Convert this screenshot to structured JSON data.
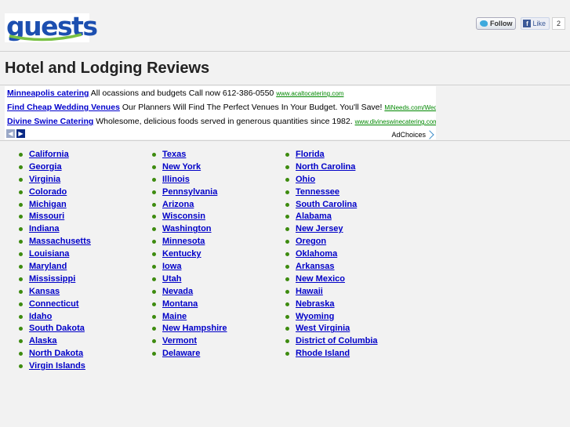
{
  "header": {
    "logo_text": "guests",
    "follow_label": "Follow",
    "like_label": "Like",
    "like_count": "2"
  },
  "page": {
    "title": "Hotel and Lodging Reviews"
  },
  "ads": {
    "items": [
      {
        "title": "Minneapolis catering",
        "text": "All ocassions and budgets Call now 612-386-0550",
        "url": "www.acaltocatering.com"
      },
      {
        "title": "Find Cheap Wedding Venues",
        "text": "Our Planners Will Find The Perfect Venues In Your Budget. You'll Save!",
        "url": "MiNeeds.com/Wedding-F"
      },
      {
        "title": "Divine Swine Catering",
        "text": "Wholesome, delicious foods served in generous quantities since 1982.",
        "url": "www.divineswinecatering.com"
      }
    ],
    "prev_arrow": "◀",
    "next_arrow": "▶",
    "adchoices_label": "AdChoices"
  },
  "states": {
    "col1": [
      "California",
      "Georgia",
      "Virginia",
      "Colorado",
      "Michigan",
      "Missouri",
      "Indiana",
      "Massachusetts",
      "Louisiana",
      "Maryland",
      "Mississippi",
      "Kansas",
      "Connecticut",
      "Idaho",
      "South Dakota",
      "Alaska",
      "North Dakota",
      "Virgin Islands"
    ],
    "col2": [
      "Texas",
      "New York",
      "Illinois",
      "Pennsylvania",
      "Arizona",
      "Wisconsin",
      "Washington",
      "Minnesota",
      "Kentucky",
      "Iowa",
      "Utah",
      "Nevada",
      "Montana",
      "Maine",
      "New Hampshire",
      "Vermont",
      "Delaware"
    ],
    "col3": [
      "Florida",
      "North Carolina",
      "Ohio",
      "Tennessee",
      "South Carolina",
      "Alabama",
      "New Jersey",
      "Oregon",
      "Oklahoma",
      "Arkansas",
      "New Mexico",
      "Hawaii",
      "Nebraska",
      "Wyoming",
      "West Virginia",
      "District of Columbia",
      "Rhode Island"
    ]
  },
  "colors": {
    "link": "#0000c8",
    "bullet": "#3d8b0f",
    "logo": "#1c4fb0"
  }
}
